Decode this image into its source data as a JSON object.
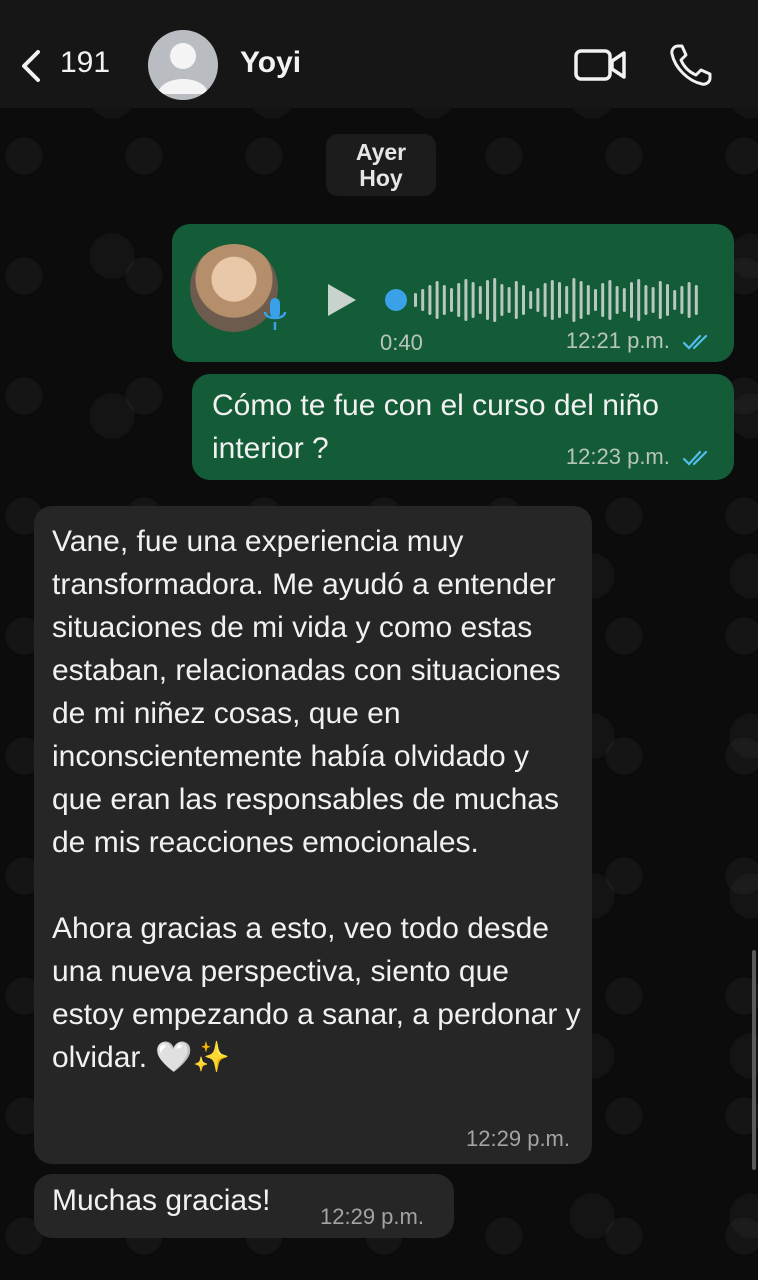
{
  "header": {
    "back_count": "191",
    "contact_name": "Yoyi",
    "back_icon": "chevron-left-icon",
    "video_icon": "video-camera-icon",
    "call_icon": "phone-icon"
  },
  "date_separator": {
    "line1": "Ayer",
    "line2": "Hoy"
  },
  "messages": [
    {
      "type": "voice",
      "direction": "outgoing",
      "duration": "0:40",
      "time": "12:21 p.m.",
      "status": "read"
    },
    {
      "type": "text",
      "direction": "outgoing",
      "text": "Cómo te fue con el curso del niño interior ?",
      "time": "12:23 p.m.",
      "status": "read"
    },
    {
      "type": "text",
      "direction": "incoming",
      "paragraph1": "Vane, fue  una experiencia muy transformadora. Me ayudó a entender situaciones de mi vida y como estas estaban, relacionadas con situaciones de mi niñez cosas, que en inconscientemente había olvidado y que eran las responsables de muchas de mis reacciones emocionales.",
      "paragraph2": "Ahora gracias a esto, veo todo desde una nueva perspectiva, siento que estoy empezando a sanar, a perdonar y olvidar. 🤍✨",
      "time": "12:29 p.m."
    },
    {
      "type": "text",
      "direction": "incoming",
      "text": "Muchas gracias!",
      "time": "12:29 p.m."
    }
  ],
  "colors": {
    "outgoing_bubble": "#135c37",
    "incoming_bubble": "#262626",
    "read_ticks": "#53bdeb",
    "header_bg": "#161616"
  }
}
